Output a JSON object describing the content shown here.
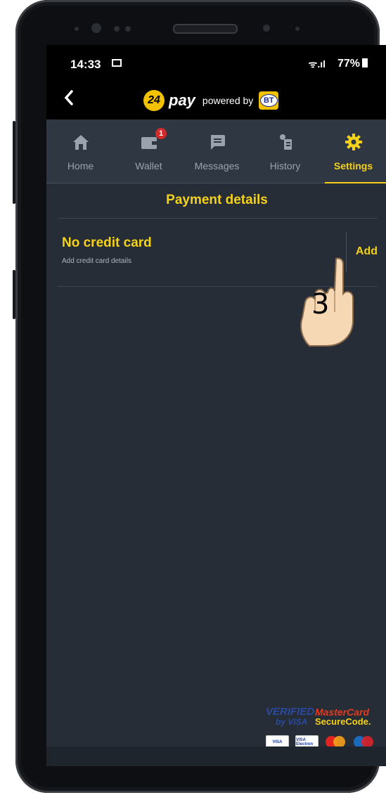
{
  "status_bar": {
    "time": "14:33",
    "signal": "ᯤ.ıl",
    "battery": "77%"
  },
  "app_bar": {
    "back_icon": "chevron-left-icon",
    "logo_badge": "24",
    "logo_word": "pay",
    "powered_by": "powered by",
    "bank_logo": "BT"
  },
  "tabs": [
    {
      "label": "Home",
      "icon": "house-icon",
      "active": false
    },
    {
      "label": "Wallet",
      "icon": "wallet-icon",
      "active": false,
      "badge": "1"
    },
    {
      "label": "Messages",
      "icon": "message-icon",
      "active": false
    },
    {
      "label": "History",
      "icon": "history-icon",
      "active": false
    },
    {
      "label": "Settings",
      "icon": "gear-icon",
      "active": true
    }
  ],
  "page": {
    "title": "Payment details"
  },
  "credit_card": {
    "title": "No credit card",
    "subtitle": "Add credit card details",
    "add_label": "Add"
  },
  "security_logos": {
    "verified": "VERIFIED",
    "by_visa": "by VISA",
    "mastercard": "MasterCard",
    "securecode": "SecureCode.",
    "card_marks": [
      "VISA",
      "VISA Electron",
      "MasterCard",
      "Maestro"
    ]
  },
  "overlay": {
    "step_number": "3"
  },
  "colors": {
    "accent": "#f5d21a",
    "background": "#262d37",
    "tab_bar": "#2f3742",
    "badge": "#d12a2a"
  }
}
